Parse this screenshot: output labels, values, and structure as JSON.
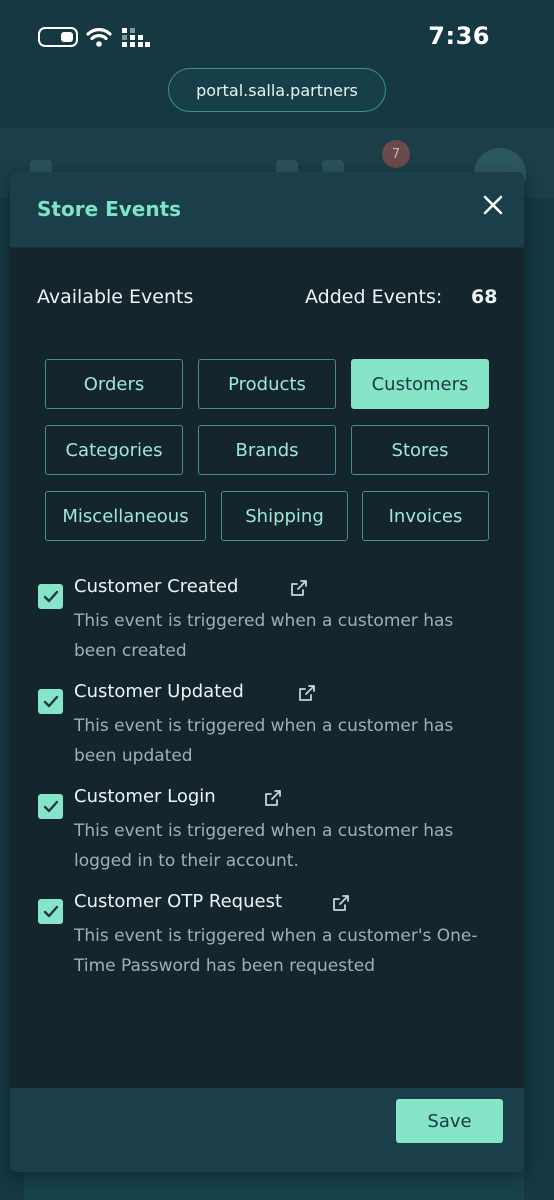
{
  "status_bar": {
    "time": "7:36"
  },
  "browser": {
    "url": "portal.salla.partners"
  },
  "background": {
    "notification_count": "7"
  },
  "modal": {
    "title": "Store Events",
    "available_label": "Available Events",
    "added_label": "Added Events:",
    "added_count": "68",
    "tabs": [
      {
        "label": "Orders",
        "active": false
      },
      {
        "label": "Products",
        "active": false
      },
      {
        "label": "Customers",
        "active": true
      },
      {
        "label": "Categories",
        "active": false
      },
      {
        "label": "Brands",
        "active": false
      },
      {
        "label": "Stores",
        "active": false
      },
      {
        "label": "Miscellaneous",
        "active": false
      },
      {
        "label": "Shipping",
        "active": false
      },
      {
        "label": "Invoices",
        "active": false
      }
    ],
    "events": [
      {
        "title": "Customer Created",
        "description": "This event is triggered when a customer has been created",
        "checked": true
      },
      {
        "title": "Customer Updated",
        "description": "This event is triggered when a customer has been updated",
        "checked": true
      },
      {
        "title": "Customer Login",
        "description": "This event is triggered when a customer has logged in to their account.",
        "checked": true
      },
      {
        "title": "Customer OTP Request",
        "description": "This event is triggered when a customer's One-Time Password has been requested",
        "checked": true
      }
    ],
    "save_label": "Save"
  },
  "colors": {
    "accent": "#86e4c9",
    "title_accent": "#7fe3c8",
    "modal_bg": "#14252d",
    "header_bg": "#1b3f4a",
    "page_bg": "#153843"
  }
}
